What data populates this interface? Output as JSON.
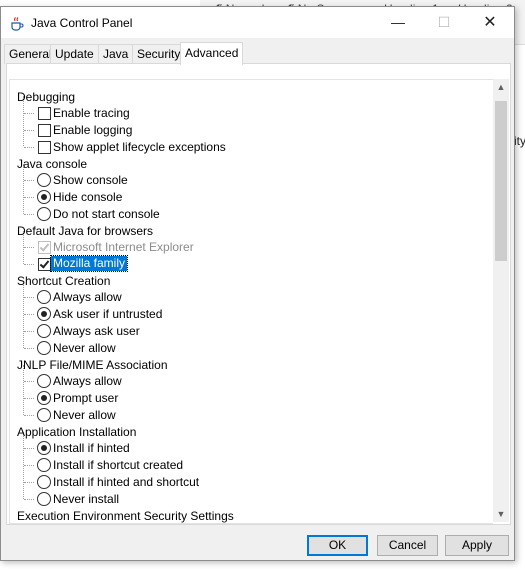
{
  "background": {
    "ribbon_styles": [
      "¶ Normal",
      "¶ No Spac...",
      "Heading 1",
      "Heading 2"
    ],
    "edge_text": "ity"
  },
  "window": {
    "title": "Java Control Panel",
    "minimize": "—",
    "maximize": "☐",
    "close": "✕"
  },
  "tabs": [
    "General",
    "Update",
    "Java",
    "Security",
    "Advanced"
  ],
  "active_tab": "Advanced",
  "tree": {
    "debugging": {
      "label": "Debugging",
      "items": [
        "Enable tracing",
        "Enable logging",
        "Show applet lifecycle exceptions"
      ]
    },
    "java_console": {
      "label": "Java console",
      "items": [
        "Show console",
        "Hide console",
        "Do not start console"
      ],
      "selected": "Hide console"
    },
    "default_browser": {
      "label": "Default Java for browsers",
      "items": [
        "Microsoft Internet Explorer",
        "Mozilla family"
      ]
    },
    "shortcut_creation": {
      "label": "Shortcut Creation",
      "items": [
        "Always allow",
        "Ask user if untrusted",
        "Always ask user",
        "Never allow"
      ],
      "selected": "Ask user if untrusted"
    },
    "jnlp": {
      "label": "JNLP File/MIME Association",
      "items": [
        "Always allow",
        "Prompt user",
        "Never allow"
      ],
      "selected": "Prompt user"
    },
    "app_install": {
      "label": "Application Installation",
      "items": [
        "Install if hinted",
        "Install if shortcut created",
        "Install if hinted and shortcut",
        "Never install"
      ],
      "selected": "Install if hinted"
    },
    "exec_env": {
      "label": "Execution Environment Security Settings"
    }
  },
  "buttons": {
    "ok": "OK",
    "cancel": "Cancel",
    "apply": "Apply"
  },
  "colors": {
    "selection": "#0078d7",
    "dialog_bg": "#f0f0f0"
  }
}
